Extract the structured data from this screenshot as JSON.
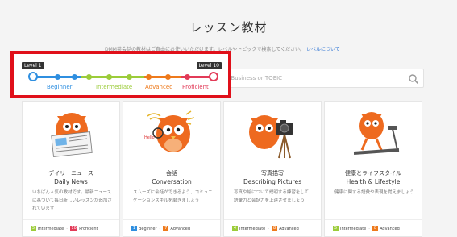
{
  "header": {
    "title": "レッスン教材",
    "subtitle": "DMM英会話の教材はご自由にお使いいただけます。レベルやトピックで検索してください。",
    "subtitle_link": "レベルについて"
  },
  "search": {
    "placeholder": "e.g. Business or TOEIC"
  },
  "level_slider": {
    "min_label": "Level 1",
    "max_label": "Level 10",
    "segments": [
      {
        "label": "Beginner",
        "color": "#2f8fe0"
      },
      {
        "label": "Intermediate",
        "color": "#9ccc3a"
      },
      {
        "label": "Advanced",
        "color": "#ee7a1c"
      },
      {
        "label": "Proficient",
        "color": "#e23b58"
      }
    ]
  },
  "cards": [
    {
      "title_jp": "デイリーニュース",
      "title_en": "Daily News",
      "desc": "いちばん人気の教材です。最新ニュースに基づいて毎日新しいレッスンが追加されています",
      "from_num": "5",
      "from_label": "Intermediate",
      "from_color": "#9ccc3a",
      "to_num": "10",
      "to_label": "Proficient",
      "to_color": "#e23b58",
      "icon": "newspaper-owl-icon"
    },
    {
      "title_jp": "会話",
      "title_en": "Conversation",
      "desc": "スムーズに会話ができるよう、コミュニケーションスキルを磨きましょう",
      "from_num": "1",
      "from_label": "Beginner",
      "from_color": "#2f8fe0",
      "to_num": "7",
      "to_label": "Advanced",
      "to_color": "#ee7a1c",
      "icon": "chat-owl-icon"
    },
    {
      "title_jp": "写真描写",
      "title_en": "Describing Pictures",
      "desc": "写真や絵について説明する練習をして、語彙力と会話力を上達させましょう",
      "from_num": "4",
      "from_label": "Intermediate",
      "from_color": "#9ccc3a",
      "to_num": "8",
      "to_label": "Advanced",
      "to_color": "#ee7a1c",
      "icon": "camera-owl-icon"
    },
    {
      "title_jp": "健康とライフスタイル",
      "title_en": "Health & Lifestyle",
      "desc": "健康に関する語彙や表現を覚えましょう",
      "from_num": "5",
      "from_label": "Intermediate",
      "from_color": "#9ccc3a",
      "to_num": "8",
      "to_label": "Advanced",
      "to_color": "#ee7a1c",
      "icon": "treadmill-owl-icon"
    }
  ]
}
